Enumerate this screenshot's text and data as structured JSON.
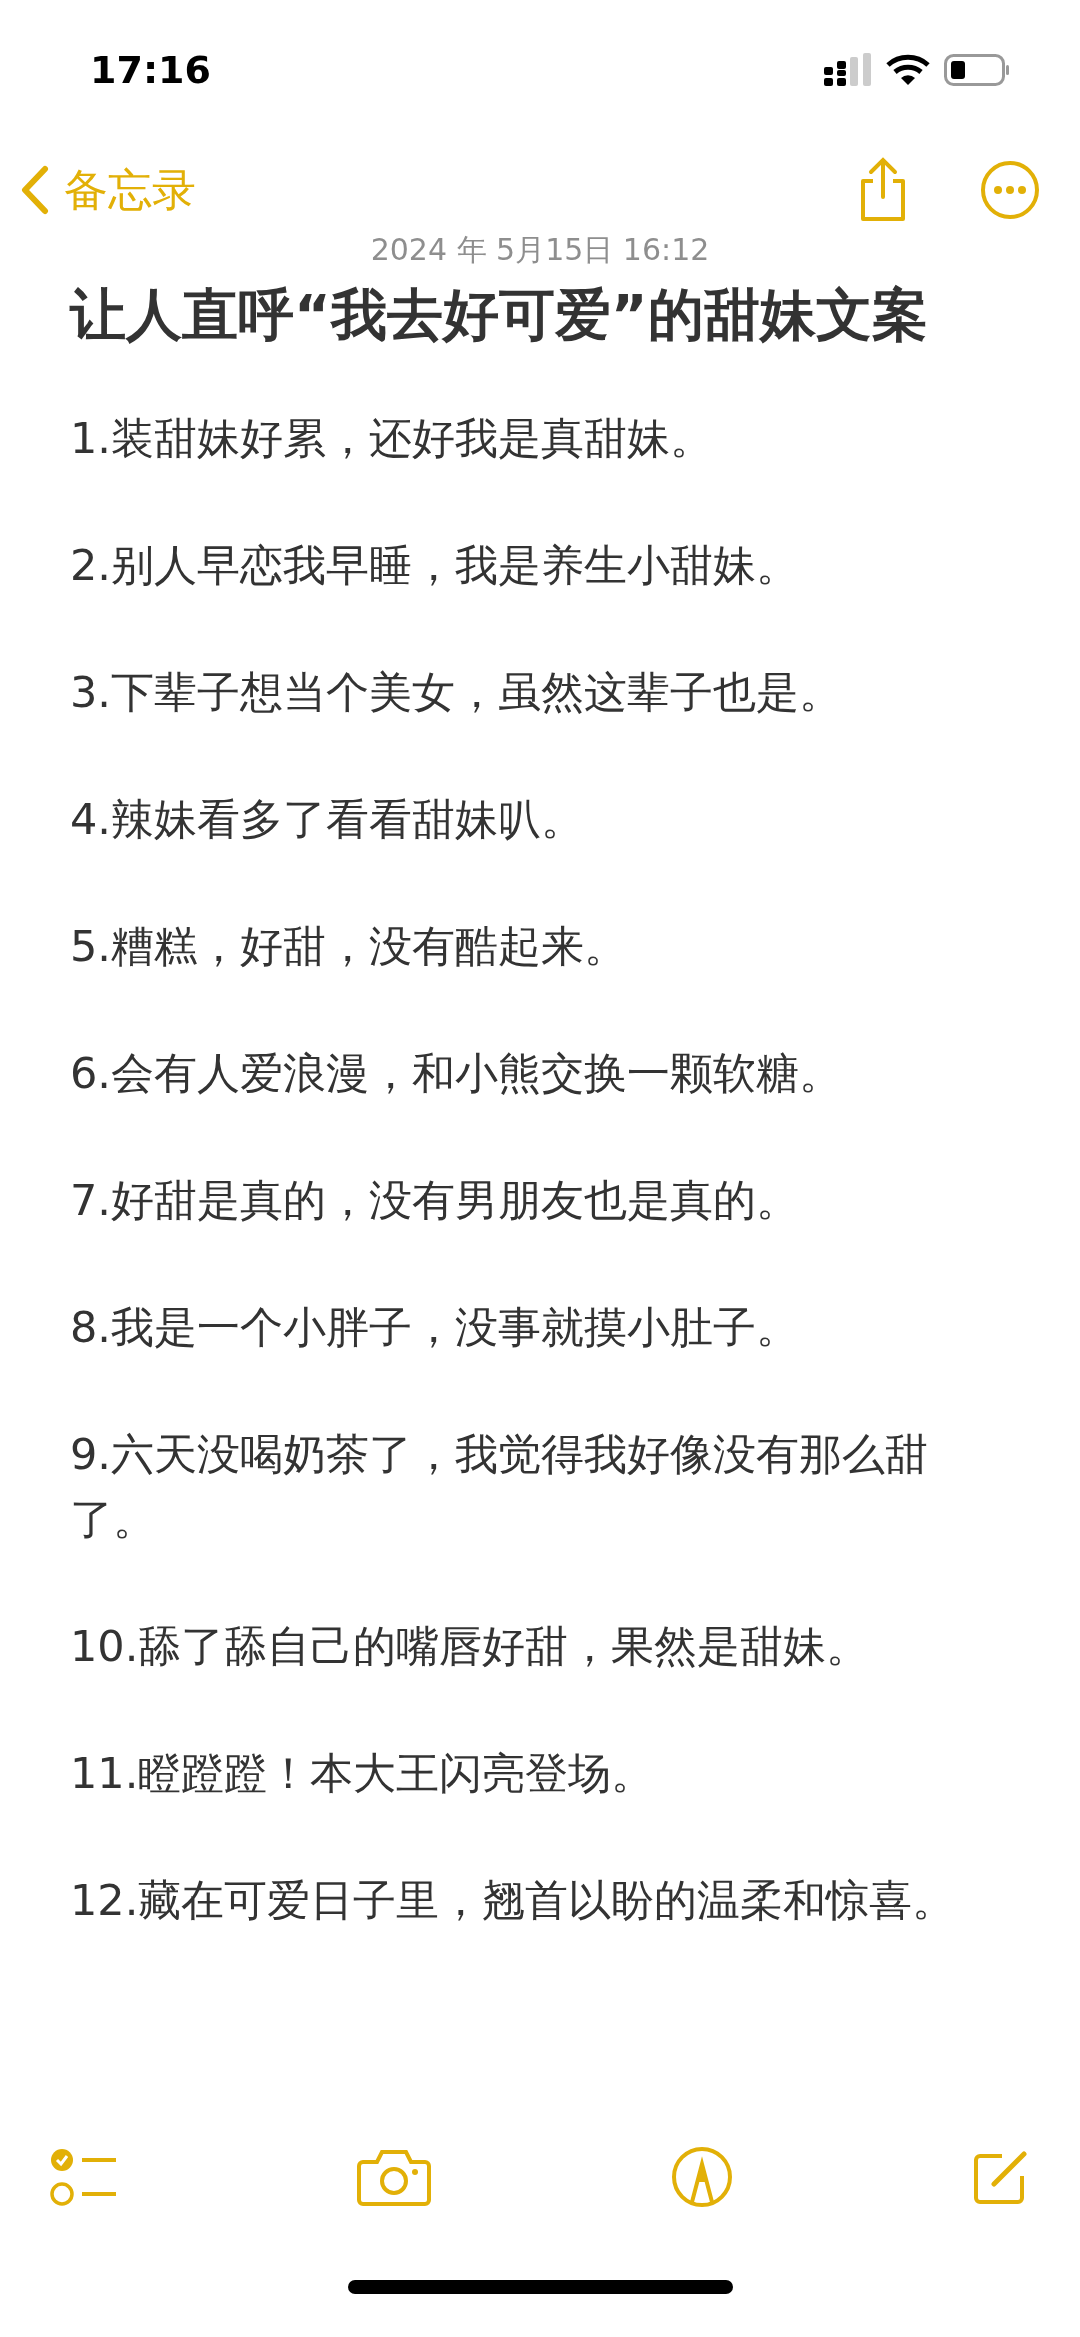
{
  "status_bar": {
    "time": "17:16"
  },
  "nav": {
    "back_label": "备忘录"
  },
  "note": {
    "date": "2024 年 5月15日 16:12",
    "title": "让人直呼“我去好可爱”的甜妹文案",
    "lines": [
      "1.装甜妹好累，还好我是真甜妹。",
      "2.别人早恋我早睡，我是养生小甜妹。",
      "3.下辈子想当个美女，虽然这辈子也是。",
      "4.辣妹看多了看看甜妹叭。",
      "5.糟糕，好甜，没有酷起来。",
      "6.会有人爱浪漫，和小熊交换一颗软糖。",
      "7.好甜是真的，没有男朋友也是真的。",
      "8.我是一个小胖子，没事就摸小肚子。",
      "9.六天没喝奶茶了，我觉得我好像没有那么甜了。",
      "10.舔了舔自己的嘴唇好甜，果然是甜妹。",
      "11.瞪蹬蹬！本大王闪亮登场。",
      "12.藏在可爱日子里，翘首以盼的温柔和惊喜。"
    ]
  }
}
